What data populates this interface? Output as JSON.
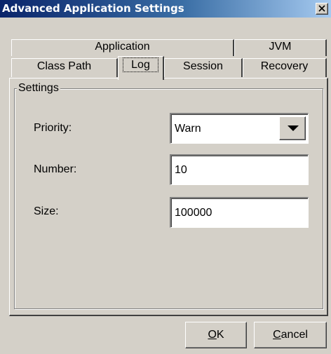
{
  "window": {
    "title": "Advanced Application Settings",
    "close_icon": "close-x-icon"
  },
  "tabs": {
    "back_row": [
      {
        "label": "Application"
      },
      {
        "label": "JVM"
      }
    ],
    "front_row": [
      {
        "label": "Class Path"
      },
      {
        "label": "Log",
        "selected": true
      },
      {
        "label": "Session"
      },
      {
        "label": "Recovery"
      }
    ]
  },
  "settings": {
    "group_label": "Settings",
    "priority": {
      "label": "Priority:",
      "value": "Warn",
      "dropdown_icon": "triangle-down-icon"
    },
    "number": {
      "label": "Number:",
      "value": "10"
    },
    "size": {
      "label": "Size:",
      "value": "100000"
    }
  },
  "buttons": {
    "ok": {
      "mnemonic": "O",
      "rest": "K"
    },
    "cancel": {
      "mnemonic": "C",
      "rest": "ancel"
    }
  },
  "colors": {
    "dialog_bg": "#d4d0c8",
    "titlebar_start": "#0a246a",
    "titlebar_end": "#a6caf0",
    "title_text": "#ffffff"
  }
}
